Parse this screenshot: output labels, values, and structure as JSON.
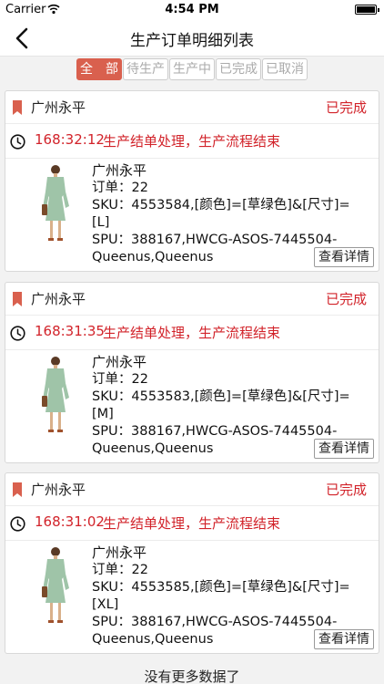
{
  "status_bar": {
    "carrier": "Carrier",
    "time": "4:54 PM"
  },
  "nav": {
    "title": "生产订单明细列表",
    "back_icon": "chevron-left-icon"
  },
  "tabs": [
    {
      "label": "全　部",
      "active": true
    },
    {
      "label": "待生产",
      "active": false
    },
    {
      "label": "生产中",
      "active": false
    },
    {
      "label": "已完成",
      "active": false
    },
    {
      "label": "已取消",
      "active": false
    }
  ],
  "orders": [
    {
      "shop": "广州永平",
      "status": "已完成",
      "time": "168:32:12",
      "message": "生产结单处理，生产流程结束",
      "name": "广州永平",
      "order": "订单：22",
      "sku": "SKU：4553584,[颜色]=[草绿色]&[尺寸]=[L]",
      "spu1": "SPU：388167,HWCG-ASOS-7445504-",
      "spu2": "Queenus,Queenus",
      "detail_label": "查看详情"
    },
    {
      "shop": "广州永平",
      "status": "已完成",
      "time": "168:31:35",
      "message": "生产结单处理，生产流程结束",
      "name": "广州永平",
      "order": "订单：22",
      "sku": "SKU：4553583,[颜色]=[草绿色]&[尺寸]=[M]",
      "spu1": "SPU：388167,HWCG-ASOS-7445504-",
      "spu2": "Queenus,Queenus",
      "detail_label": "查看详情"
    },
    {
      "shop": "广州永平",
      "status": "已完成",
      "time": "168:31:02",
      "message": "生产结单处理，生产流程结束",
      "name": "广州永平",
      "order": "订单：22",
      "sku": "SKU：4553585,[颜色]=[草绿色]&[尺寸]=[XL]",
      "spu1": "SPU：388167,HWCG-ASOS-7445504-",
      "spu2": "Queenus,Queenus",
      "detail_label": "查看详情"
    }
  ],
  "footer": "没有更多数据了",
  "colors": {
    "accent": "#d9604e",
    "status_red": "#d2232a",
    "dress_green": "#9fc4a8"
  }
}
